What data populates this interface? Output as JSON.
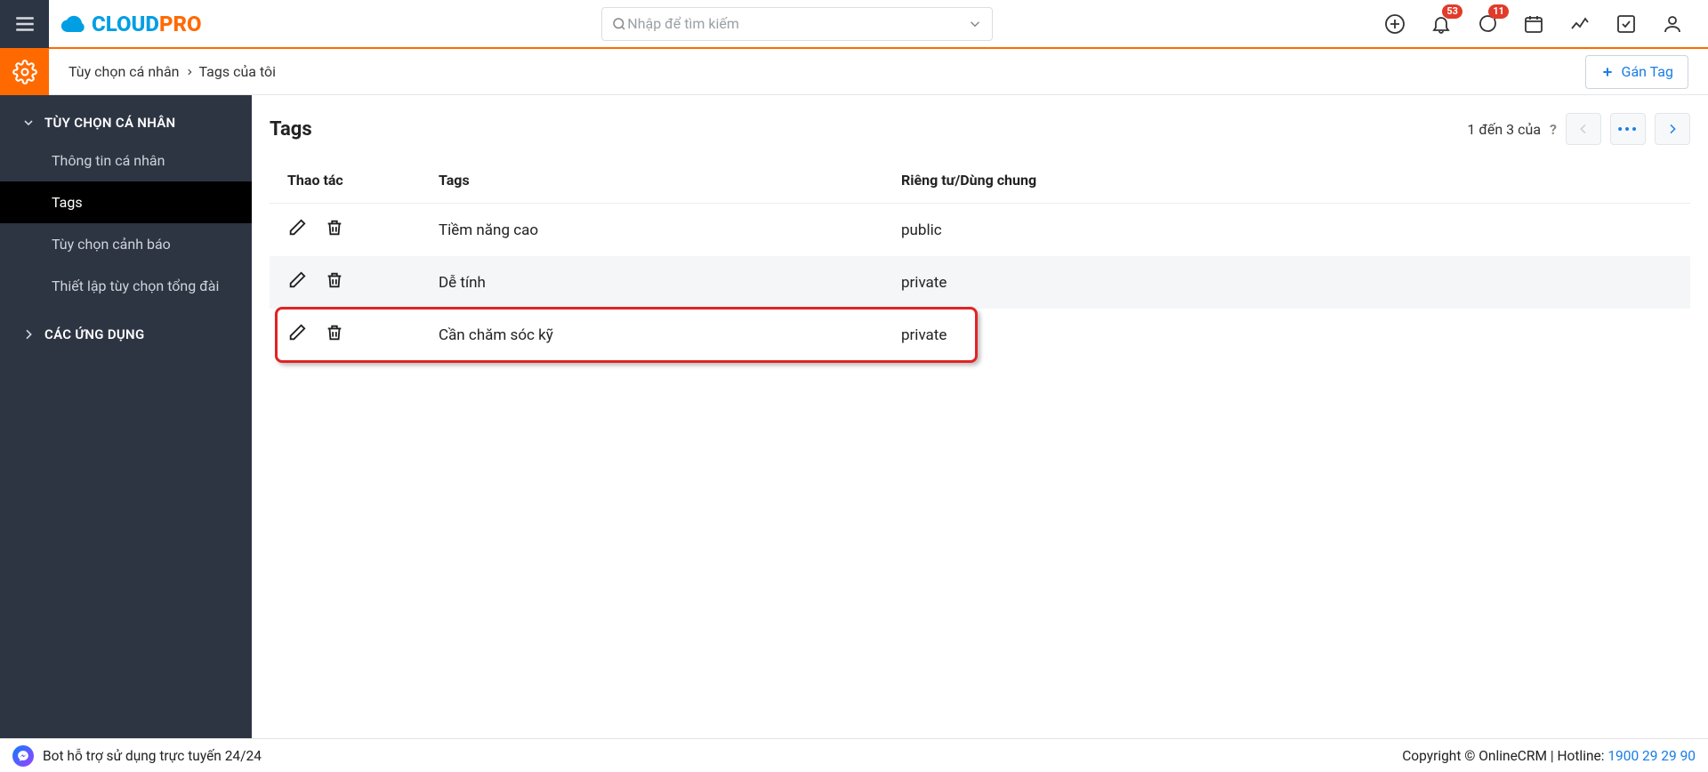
{
  "header": {
    "search_placeholder": "Nhập để tìm kiếm",
    "badges": {
      "notifications": "53",
      "messages": "11"
    }
  },
  "breadcrumb": {
    "parent": "Tùy chọn cá nhân",
    "current": "Tags của tôi",
    "button_label": "Gán Tag"
  },
  "sidebar": {
    "group1_title": "TÙY CHỌN CÁ NHÂN",
    "group2_title": "CÁC ỨNG DỤNG",
    "items": [
      {
        "label": "Thông tin cá nhân",
        "active": false
      },
      {
        "label": "Tags",
        "active": true
      },
      {
        "label": "Tùy chọn cảnh báo",
        "active": false
      },
      {
        "label": "Thiết lập tùy chọn tổng đài",
        "active": false
      }
    ]
  },
  "content": {
    "title": "Tags",
    "pagination_text": "1 đến 3 của ",
    "pagination_total": "?",
    "columns": {
      "actions": "Thao tác",
      "tags": "Tags",
      "visibility": "Riêng tư/Dùng chung"
    },
    "rows": [
      {
        "tag": "Tiềm năng cao",
        "visibility": "public",
        "highlight": false
      },
      {
        "tag": "Dễ tính",
        "visibility": "private",
        "highlight": false
      },
      {
        "tag": "Cần chăm sóc kỹ",
        "visibility": "private",
        "highlight": true
      }
    ]
  },
  "footer": {
    "bot_text": "Bot hỗ trợ sử dụng trực tuyến 24/24",
    "copyright": "Copyright © OnlineCRM | Hotline: ",
    "hotline": "1900 29 29 90"
  }
}
